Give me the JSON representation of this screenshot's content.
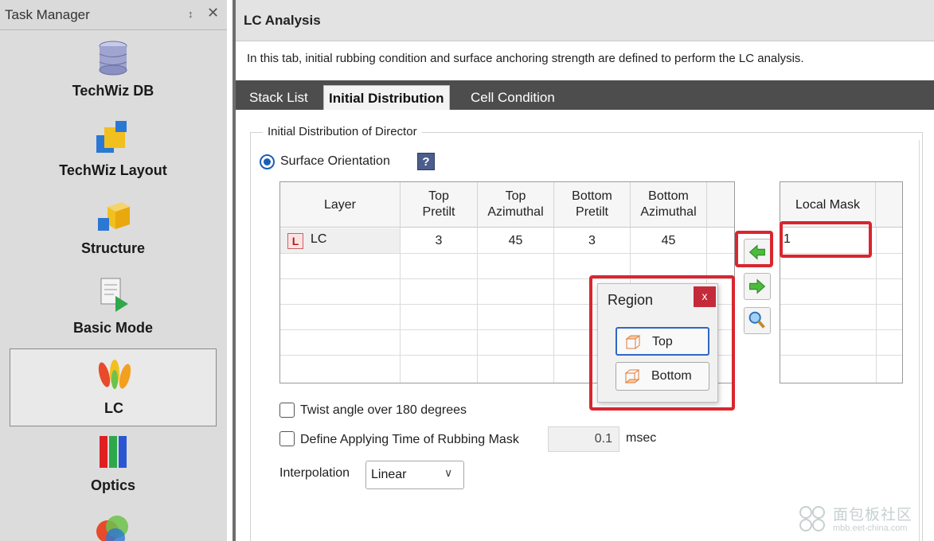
{
  "task_manager": {
    "title": "Task Manager",
    "pin_glyph": "↕",
    "close_glyph": "✕",
    "items": [
      {
        "label": "TechWiz DB",
        "icon": "database-icon"
      },
      {
        "label": "TechWiz Layout",
        "icon": "layout-icon"
      },
      {
        "label": "Structure",
        "icon": "structure-cube-icon"
      },
      {
        "label": "Basic Mode",
        "icon": "basic-mode-icon"
      },
      {
        "label": "LC",
        "icon": "lc-icon",
        "selected": true
      },
      {
        "label": "Optics",
        "icon": "optics-icon"
      },
      {
        "label": "",
        "icon": "color-circles-icon"
      }
    ]
  },
  "main": {
    "title": "LC Analysis",
    "description": "In this tab, initial rubbing condition and surface anchoring strength are defined to perform the LC analysis.",
    "tabs": [
      "Stack List",
      "Initial Distribution",
      "Cell Condition"
    ],
    "active_tab": "Initial Distribution",
    "group_title": "Initial Distribution of Director",
    "radio_label": "Surface Orientation",
    "help_glyph": "?",
    "grid": {
      "headers": [
        "Layer",
        "Top\nPretilt",
        "Top\nAzimuthal",
        "Bottom\nPretilt",
        "Bottom\nAzimuthal"
      ],
      "rows": [
        {
          "badge": "L",
          "layer": "LC",
          "top_pretilt": "3",
          "top_azimuthal": "45",
          "bottom_pretilt": "3",
          "bottom_azimuthal": "45"
        }
      ]
    },
    "mask_grid": {
      "header": "Local Mask",
      "value": "1"
    },
    "region_popup": {
      "title": "Region",
      "close_glyph": "x",
      "buttons": [
        "Top",
        "Bottom"
      ]
    },
    "twist_label": "Twist angle over 180 degrees",
    "rubbing_label": "Define Applying Time of Rubbing Mask",
    "rubbing_value": "0.1",
    "rubbing_unit": "msec",
    "interpolation_label": "Interpolation",
    "interpolation_value": "Linear",
    "chevron": "∨"
  },
  "watermark": {
    "title": "面包板社区",
    "subtitle": "mbb.eet-china.com"
  }
}
